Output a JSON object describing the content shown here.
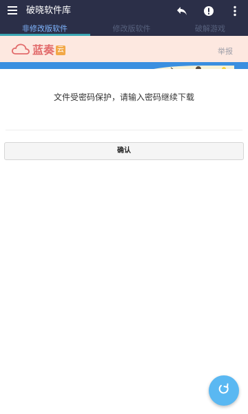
{
  "app": {
    "title": "破晓软件库"
  },
  "icons": {
    "menu": "menu-icon",
    "reply": "reply-icon",
    "alert": "alert-circle-icon",
    "more": "more-vertical-icon",
    "cloud": "cloud-icon",
    "refresh": "refresh-icon"
  },
  "tabs": [
    {
      "label": "非修改版软件",
      "active": true
    },
    {
      "label": "修改版软件",
      "active": false
    },
    {
      "label": "破解游戏",
      "active": false
    }
  ],
  "banner": {
    "logo_text": "蓝奏",
    "logo_badge": "云",
    "report_label": "举报"
  },
  "content": {
    "message": "文件受密码保护，请输入密码继续下载",
    "confirm_label": "确认"
  },
  "colors": {
    "appbar": "#2b2f48",
    "tab_active": "#7fb5ff",
    "tab_indicator": "#3aa6b3",
    "banner_bg": "#fde8e0",
    "logo": "#e26b6b",
    "fab": "#5ab8f2"
  }
}
